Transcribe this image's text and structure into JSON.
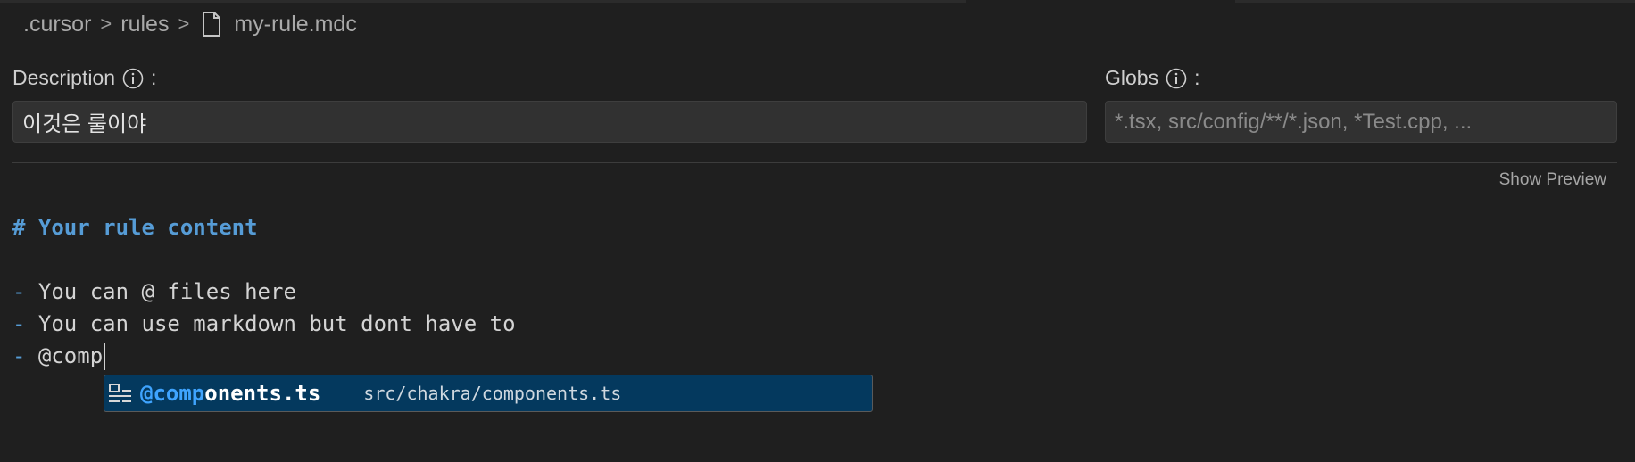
{
  "breadcrumb": {
    "items": [
      ".cursor",
      "rules",
      "my-rule.mdc"
    ],
    "separator": ">"
  },
  "form": {
    "description": {
      "label": "Description",
      "colon": ":",
      "value": "이것은 룰이야"
    },
    "globs": {
      "label": "Globs",
      "colon": ":",
      "value": "",
      "placeholder": "*.tsx, src/config/**/*.json, *Test.cpp, ..."
    }
  },
  "preview_button": "Show Preview",
  "editor": {
    "lines": [
      {
        "marker": "#",
        "text": " Your rule content"
      },
      {
        "marker": "-",
        "text": " You can @ files here"
      },
      {
        "marker": "-",
        "text": " You can use markdown but dont have to"
      },
      {
        "marker": "-",
        "text": " @comp"
      }
    ]
  },
  "suggestion": {
    "match": "@comp",
    "rest": "onents.ts",
    "path": "src/chakra/components.ts",
    "icon": "symbol-file-icon"
  },
  "colors": {
    "background": "#1f1f1f",
    "heading": "#569cd6",
    "suggestion_bg": "#04395e",
    "suggestion_match": "#3fa4ff"
  }
}
